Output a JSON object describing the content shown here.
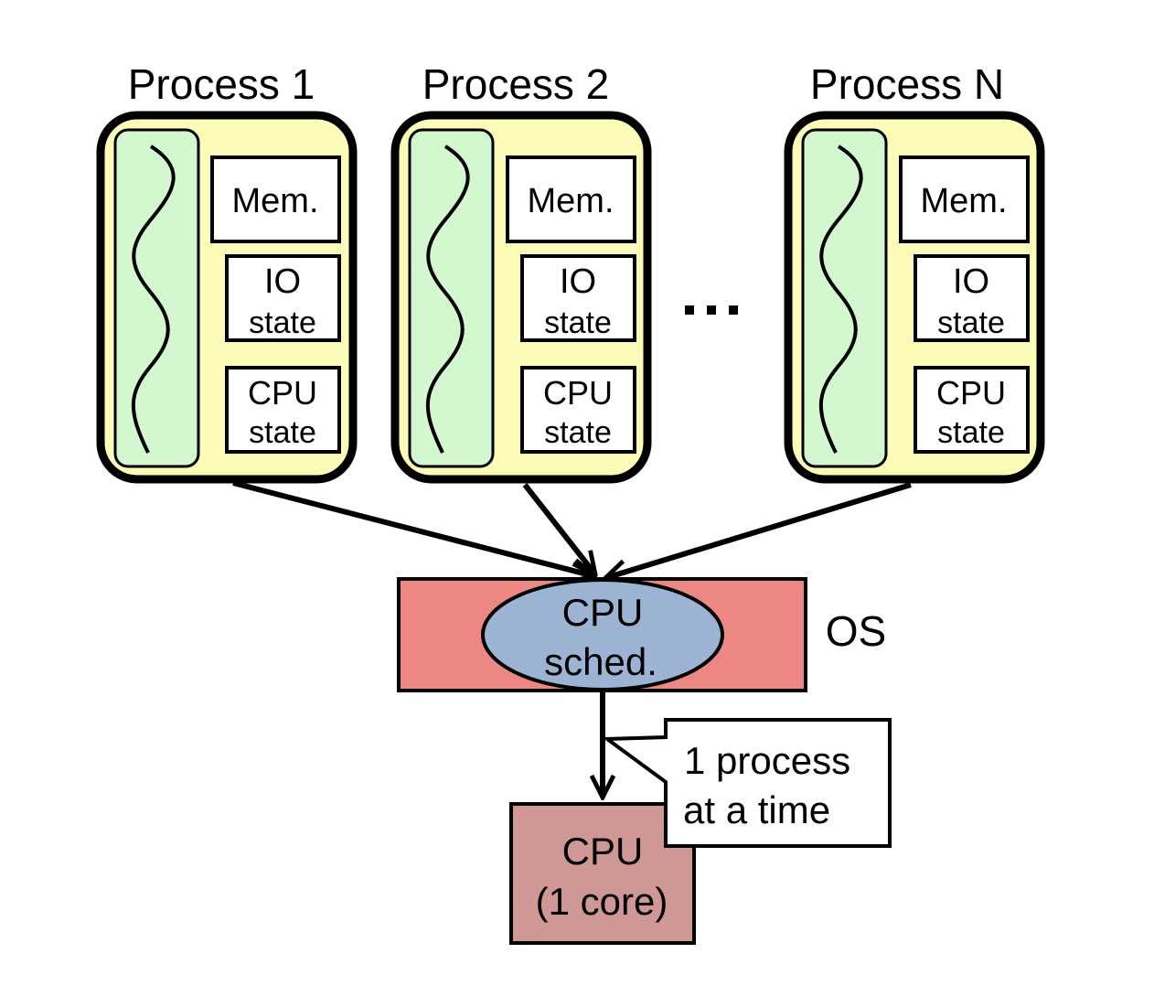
{
  "processes": [
    {
      "title": "Process 1",
      "mem": "Mem.",
      "io": [
        "IO",
        "state"
      ],
      "cpu": [
        "CPU",
        "state"
      ]
    },
    {
      "title": "Process 2",
      "mem": "Mem.",
      "io": [
        "IO",
        "state"
      ],
      "cpu": [
        "CPU",
        "state"
      ]
    },
    {
      "title": "Process N",
      "mem": "Mem.",
      "io": [
        "IO",
        "state"
      ],
      "cpu": [
        "CPU",
        "state"
      ]
    }
  ],
  "ellipsis": "...",
  "os": {
    "label": "OS",
    "scheduler": [
      "CPU",
      "sched."
    ]
  },
  "cpu": {
    "lines": [
      "CPU",
      "(1 core)"
    ]
  },
  "callout": {
    "lines": [
      "1 process",
      "at a time"
    ]
  },
  "colors": {
    "process_bg": "#fdfbb8",
    "thread_bg": "#d3f8d0",
    "os_bg": "#ec8783",
    "sched_bg": "#9db3d3",
    "cpu_bg": "#d09895"
  }
}
